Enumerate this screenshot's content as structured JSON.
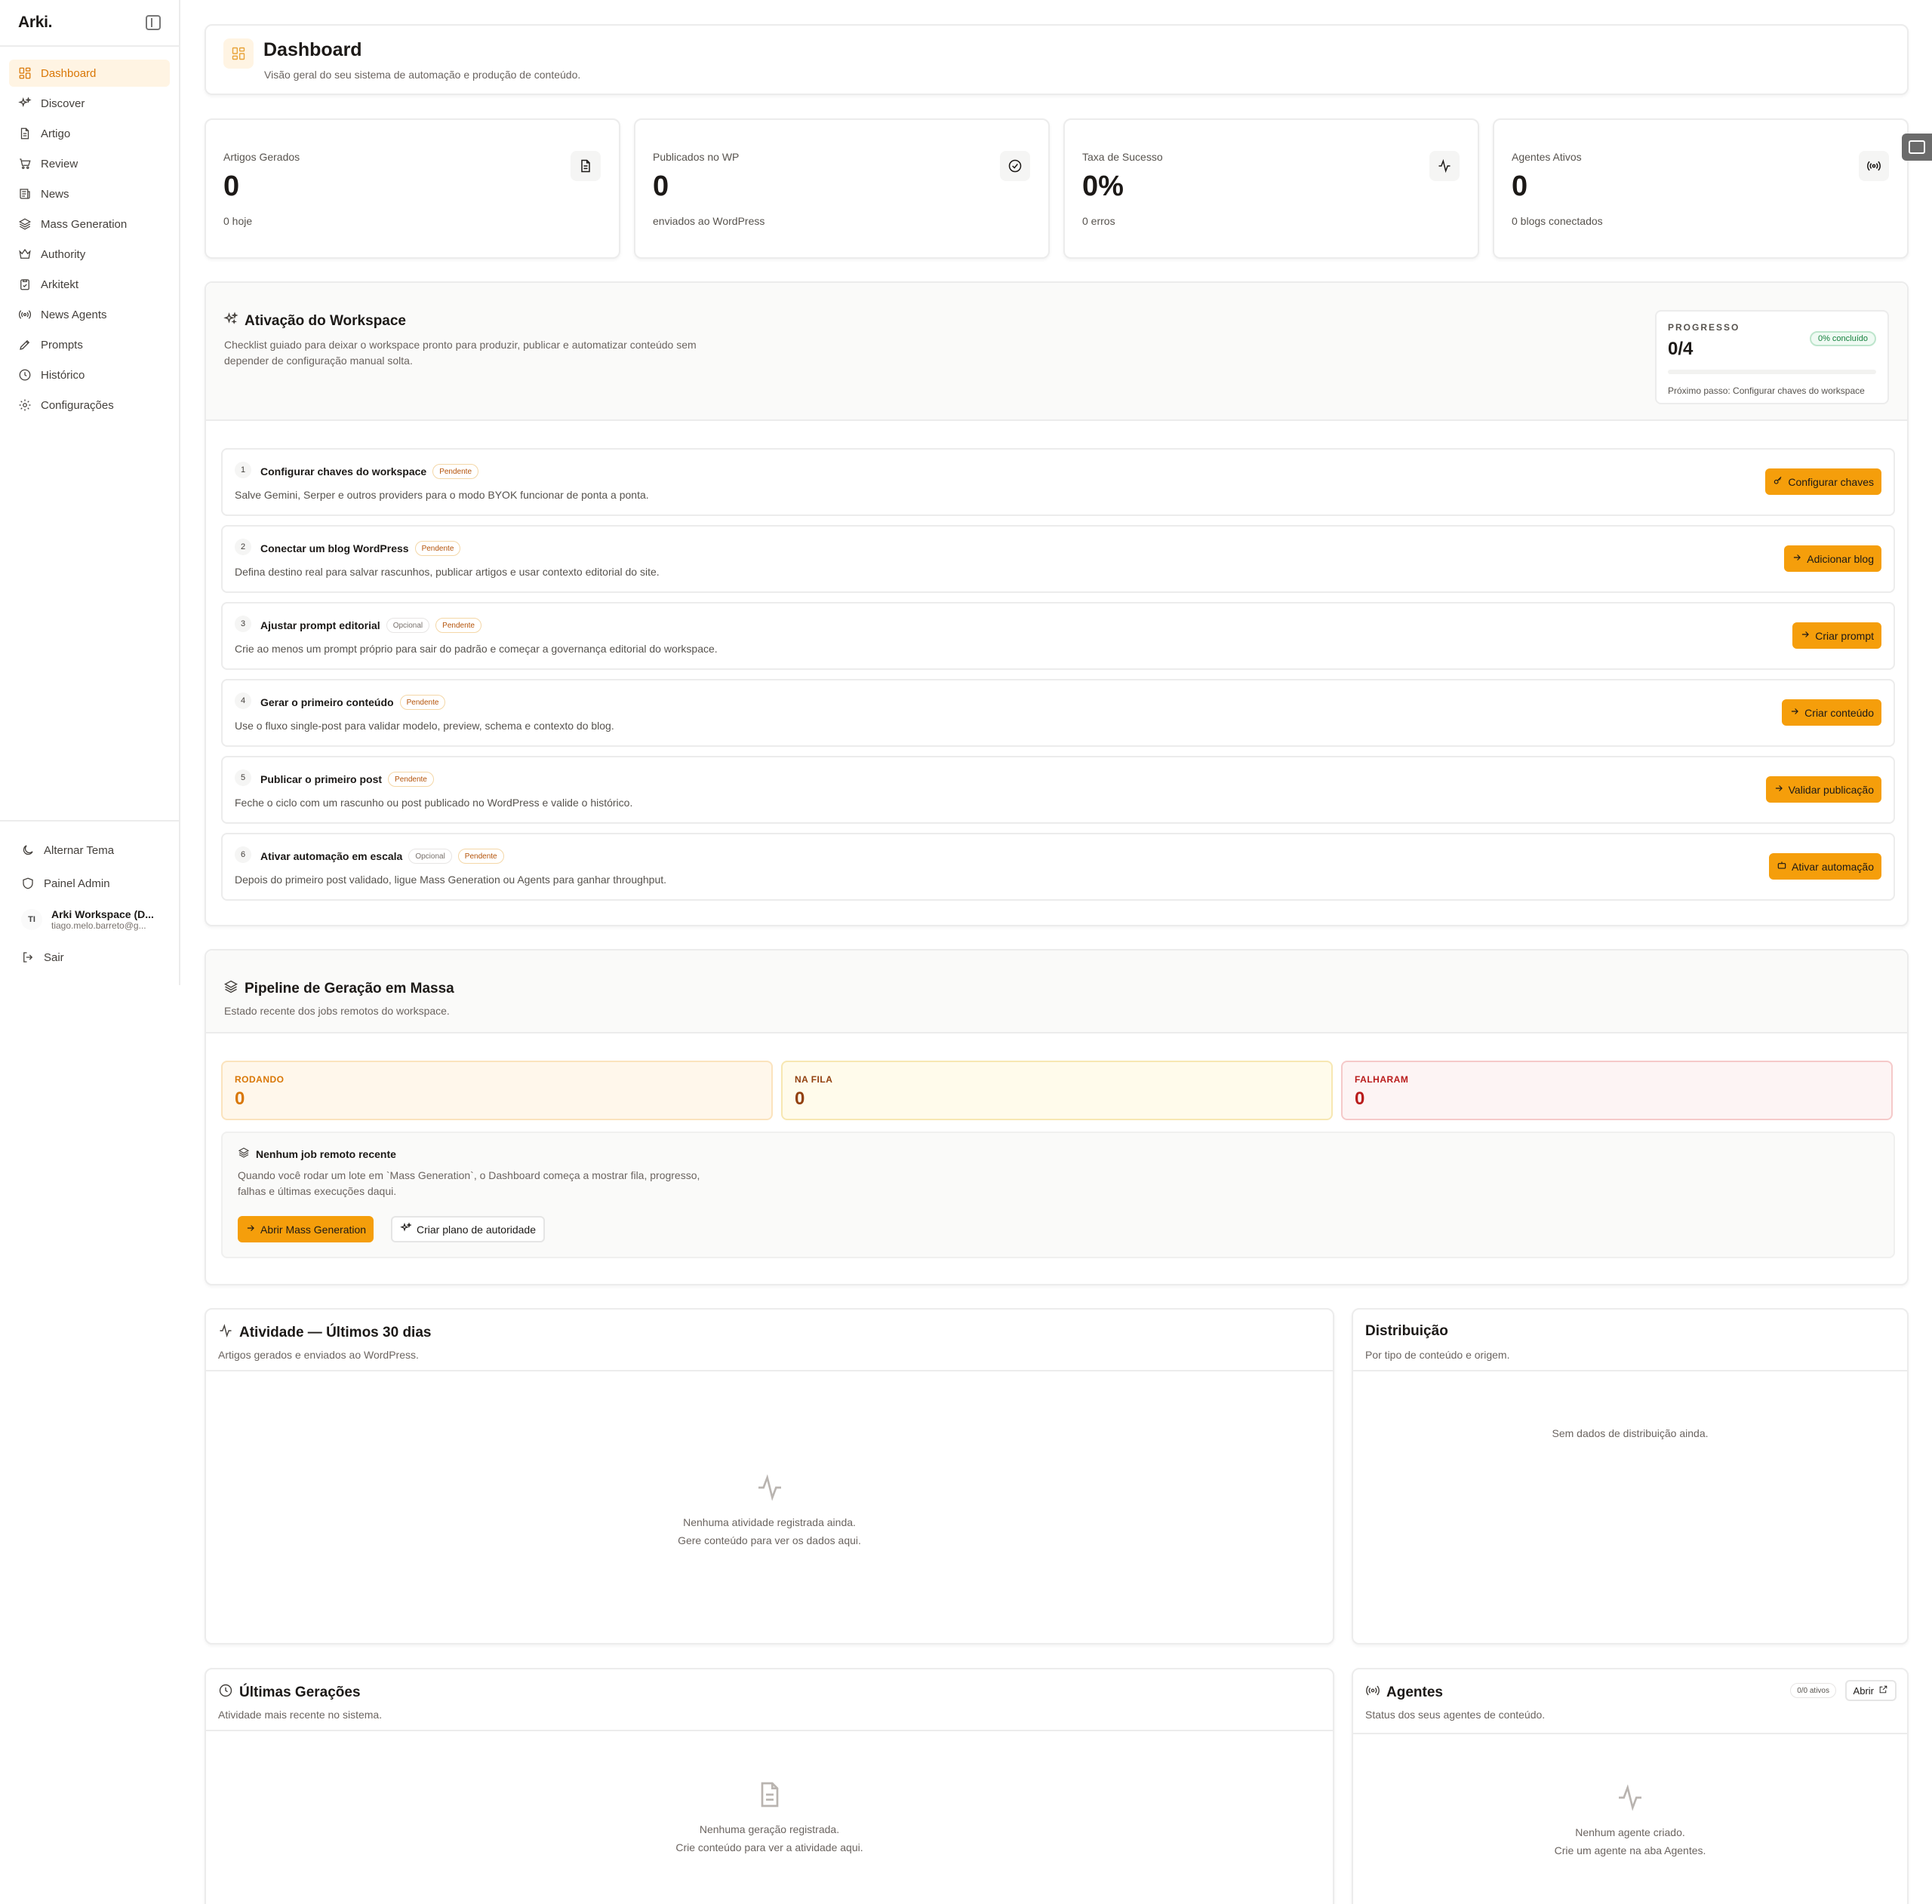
{
  "sidebar": {
    "brand": "Arki.",
    "items": [
      {
        "label": "Dashboard",
        "icon": "dashboard-icon",
        "active": true
      },
      {
        "label": "Discover",
        "icon": "sparkles-icon"
      },
      {
        "label": "Artigo",
        "icon": "document-icon"
      },
      {
        "label": "Review",
        "icon": "cart-icon"
      },
      {
        "label": "News",
        "icon": "newspaper-icon"
      },
      {
        "label": "Mass Generation",
        "icon": "layers-icon"
      },
      {
        "label": "Authority",
        "icon": "crown-icon"
      },
      {
        "label": "Arkitekt",
        "icon": "clipboard-icon"
      },
      {
        "label": "News Agents",
        "icon": "radio-icon"
      },
      {
        "label": "Prompts",
        "icon": "pen-icon"
      },
      {
        "label": "Histórico",
        "icon": "clock-icon"
      },
      {
        "label": "Configurações",
        "icon": "gear-icon"
      }
    ],
    "theme_label": "Alternar Tema",
    "admin_label": "Painel Admin",
    "user": {
      "initials": "TI",
      "name": "Arki Workspace (D...",
      "email": "tiago.melo.barreto@g..."
    },
    "logout_label": "Sair"
  },
  "header": {
    "title": "Dashboard",
    "subtitle": "Visão geral do seu sistema de automação e produção de conteúdo."
  },
  "stats": [
    {
      "label": "Artigos Gerados",
      "value": "0",
      "sub": "0 hoje",
      "icon": "document-icon"
    },
    {
      "label": "Publicados no WP",
      "value": "0",
      "sub": "enviados ao WordPress",
      "icon": "check-circle-icon"
    },
    {
      "label": "Taxa de Sucesso",
      "value": "0%",
      "sub": "0 erros",
      "icon": "activity-icon"
    },
    {
      "label": "Agentes Ativos",
      "value": "0",
      "sub": "0 blogs conectados",
      "icon": "radio-icon"
    }
  ],
  "activation": {
    "title": "Ativação do Workspace",
    "description": "Checklist guiado para deixar o workspace pronto para produzir, publicar e automatizar conteúdo sem",
    "description2": "depender de configuração manual solta.",
    "progress": {
      "label": "PROGRESSO",
      "value": "0/4",
      "badge": "0% concluído",
      "fraction": 0,
      "next": "Próximo passo: Configurar chaves do workspace"
    },
    "steps": [
      {
        "num": "1",
        "title": "Configurar chaves do workspace",
        "optional": "",
        "status": "Pendente",
        "desc": "Salve Gemini, Serper e outros providers para o modo BYOK funcionar de ponta a ponta.",
        "button": "Configurar chaves",
        "button_icon": "key-icon"
      },
      {
        "num": "2",
        "title": "Conectar um blog WordPress",
        "optional": "",
        "status": "Pendente",
        "desc": "Defina destino real para salvar rascunhos, publicar artigos e usar contexto editorial do site.",
        "button": "Adicionar blog",
        "button_icon": "arrow-right-icon"
      },
      {
        "num": "3",
        "title": "Ajustar prompt editorial",
        "optional": "Opcional",
        "status": "Pendente",
        "desc": "Crie ao menos um prompt próprio para sair do padrão e começar a governança editorial do workspace.",
        "button": "Criar prompt",
        "button_icon": "arrow-right-icon"
      },
      {
        "num": "4",
        "title": "Gerar o primeiro conteúdo",
        "optional": "",
        "status": "Pendente",
        "desc": "Use o fluxo single-post para validar modelo, preview, schema e contexto do blog.",
        "button": "Criar conteúdo",
        "button_icon": "arrow-right-icon"
      },
      {
        "num": "5",
        "title": "Publicar o primeiro post",
        "optional": "",
        "status": "Pendente",
        "desc": "Feche o ciclo com um rascunho ou post publicado no WordPress e valide o histórico.",
        "button": "Validar publicação",
        "button_icon": "arrow-right-icon"
      },
      {
        "num": "6",
        "title": "Ativar automação em escala",
        "optional": "Opcional",
        "status": "Pendente",
        "desc": "Depois do primeiro post validado, ligue Mass Generation ou Agents para ganhar throughput.",
        "button": "Ativar automação",
        "button_icon": "bot-icon"
      }
    ]
  },
  "pipeline": {
    "title": "Pipeline de Geração em Massa",
    "subtitle": "Estado recente dos jobs remotos do workspace.",
    "stats": [
      {
        "label": "RODANDO",
        "value": "0",
        "color": "#d97706",
        "bg": "#fff7eb",
        "border": "#fbe3bd"
      },
      {
        "label": "NA FILA",
        "value": "0",
        "color": "#92400e",
        "bg": "#fffbeb",
        "border": "#f7e7b2"
      },
      {
        "label": "FALHARAM",
        "value": "0",
        "color": "#b91c1c",
        "bg": "#fdf4f4",
        "border": "#f5c9c9"
      }
    ],
    "empty_title": "Nenhum job remoto recente",
    "empty_desc": "Quando você rodar um lote em `Mass Generation`, o Dashboard começa a mostrar fila, progresso,",
    "empty_desc2": "falhas e últimas execuções daqui.",
    "btn_open": "Abrir Mass Generation",
    "btn_plan": "Criar plano de autoridade"
  },
  "activity": {
    "title": "Atividade — Últimos 30 dias",
    "subtitle": "Artigos gerados e enviados ao WordPress.",
    "empty1": "Nenhuma atividade registrada ainda.",
    "empty2": "Gere conteúdo para ver os dados aqui."
  },
  "distribution": {
    "title": "Distribuição",
    "subtitle": "Por tipo de conteúdo e origem.",
    "empty": "Sem dados de distribuição ainda."
  },
  "recent": {
    "title": "Últimas Gerações",
    "subtitle": "Atividade mais recente no sistema.",
    "empty1": "Nenhuma geração registrada.",
    "empty2": "Crie conteúdo para ver a atividade aqui."
  },
  "agents": {
    "title": "Agentes",
    "subtitle": "Status dos seus agentes de conteúdo.",
    "badge": "0/0 ativos",
    "open_label": "Abrir",
    "empty1": "Nenhum agente criado.",
    "empty2": "Crie um agente na aba Agentes."
  },
  "colors": {
    "accent": "#f59e0b",
    "accent_text": "#d97706",
    "accent_bg": "#fff4e3"
  }
}
